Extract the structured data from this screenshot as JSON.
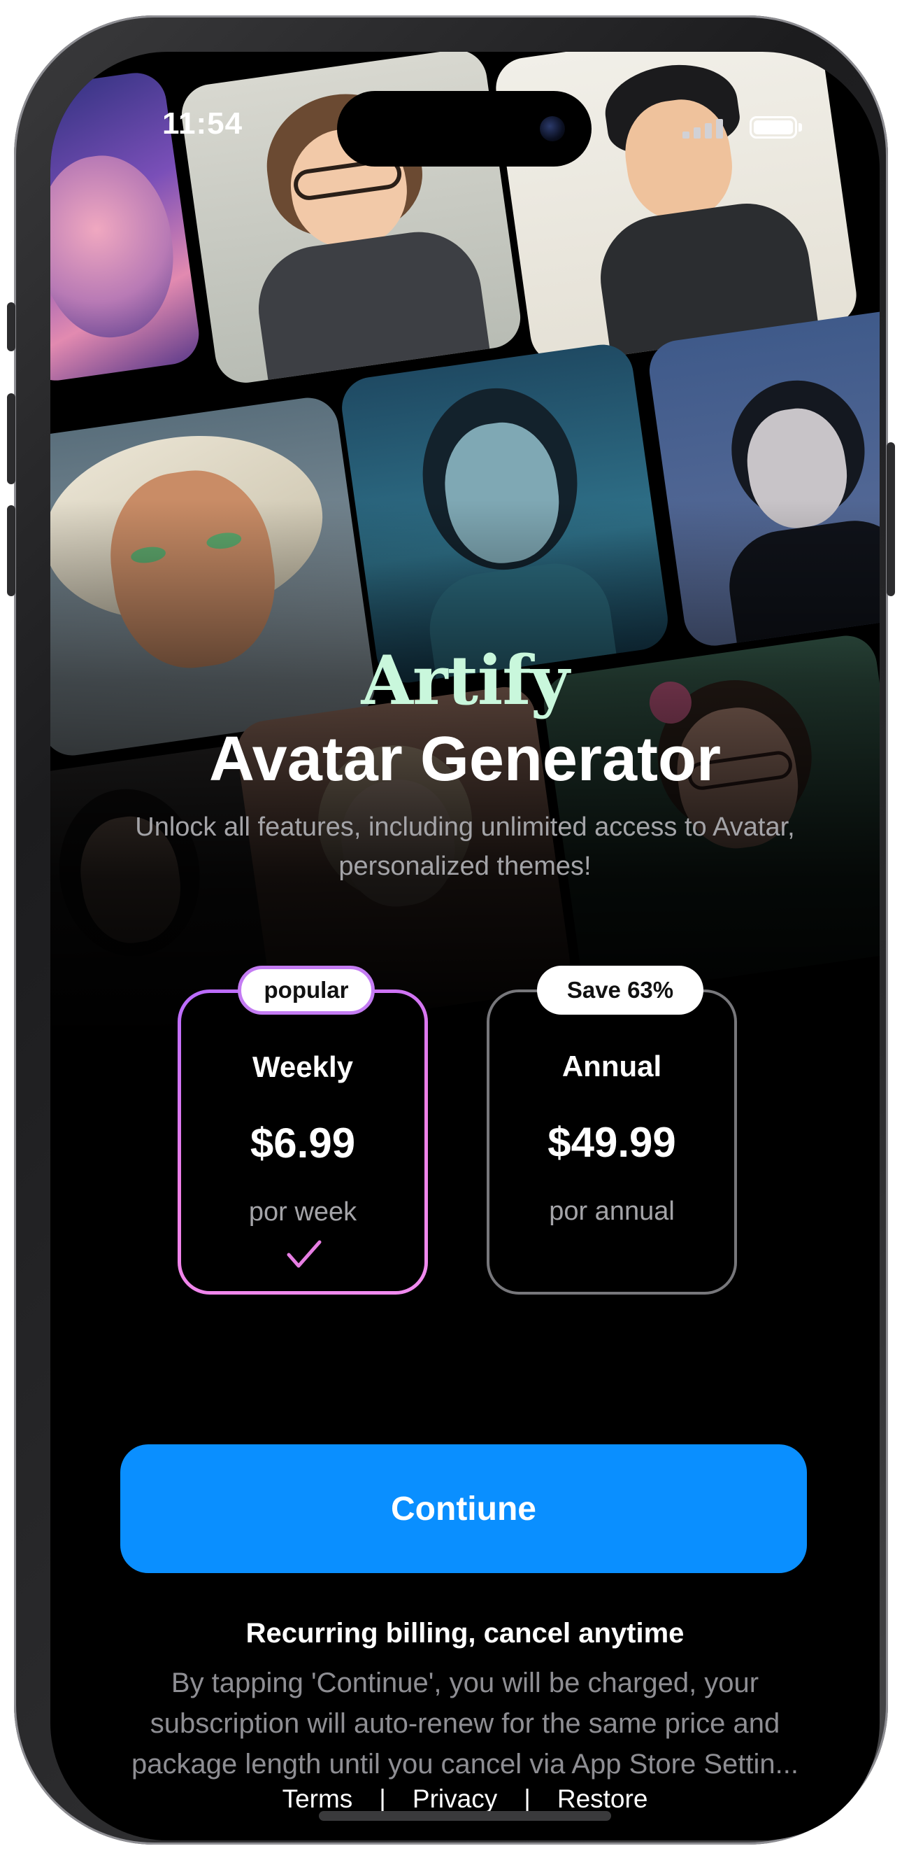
{
  "status_bar": {
    "time": "11:54"
  },
  "brand": {
    "name": "Artify",
    "headline": "Avatar Generator"
  },
  "subtitle": "Unlock all features, including unlimited access to Avatar, personalized themes!",
  "plans": [
    {
      "badge": "popular",
      "name": "Weekly",
      "price": "$6.99",
      "period": "por week",
      "selected": true
    },
    {
      "badge": "Save 63%",
      "name": "Annual",
      "price": "$49.99",
      "period": "por annual",
      "selected": false
    }
  ],
  "continue_label": "Contiune",
  "recurring_note": "Recurring billing, cancel anytime",
  "legal_text": "By tapping 'Continue', you will be charged, your subscription will auto-renew for the same price and package length until you cancel via App Store Settin...",
  "links": {
    "terms": "Terms",
    "privacy": "Privacy",
    "restore": "Restore",
    "separator": "|"
  },
  "colors": {
    "accent": "#0a8fff",
    "brand": "#c9f7dc",
    "selected_border": "#ee7fe6",
    "background": "#000000"
  },
  "icons": [
    "check-icon",
    "battery-icon",
    "signal-icon",
    "camera-icon"
  ]
}
